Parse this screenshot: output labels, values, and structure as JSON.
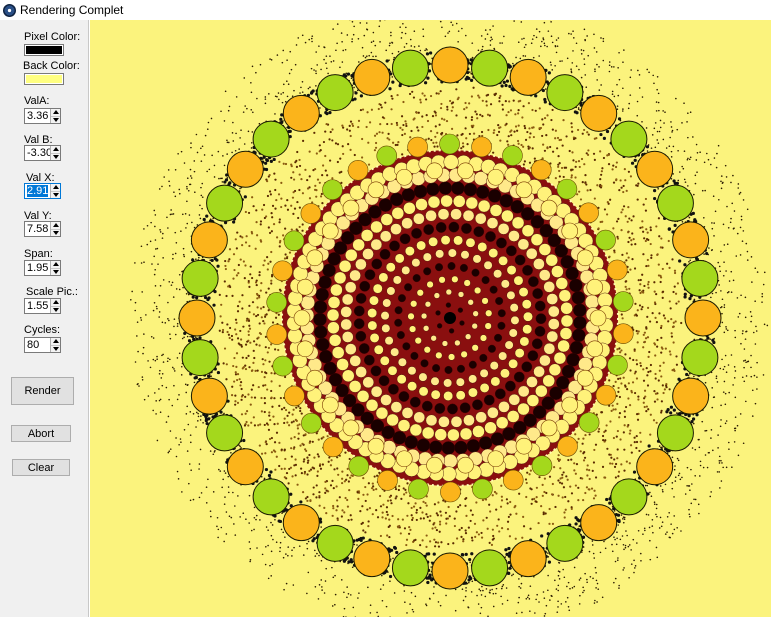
{
  "window": {
    "title": "Rendering Complet",
    "icon": "app-icon"
  },
  "controls": {
    "pixel_color_label": "Pixel Color:",
    "pixel_color": "#000000",
    "back_color_label": "Back Color:",
    "back_color": "#ffff80",
    "val_a_label": "ValA:",
    "val_a": "3.36",
    "val_b_label": "Val B:",
    "val_b": "-3.30",
    "val_x_label": "Val X:",
    "val_x": "2.91",
    "val_y_label": "Val Y:",
    "val_y": "7.58",
    "span_label": "Span:",
    "span": "1.95",
    "scale_label": "Scale Pic.:",
    "scale": "1.55",
    "cycles_label": "Cycles:",
    "cycles": "80"
  },
  "buttons": {
    "render": "Render",
    "abort": "Abort",
    "clear": "Clear"
  },
  "colors": {
    "canvas_background": "#fbf37d",
    "panel_background": "#f0f0f0",
    "green_disc": "#a4d81c",
    "orange_disc": "#fbb41b",
    "dark_red": "#8a0f0f",
    "selection": "#0078d7"
  }
}
